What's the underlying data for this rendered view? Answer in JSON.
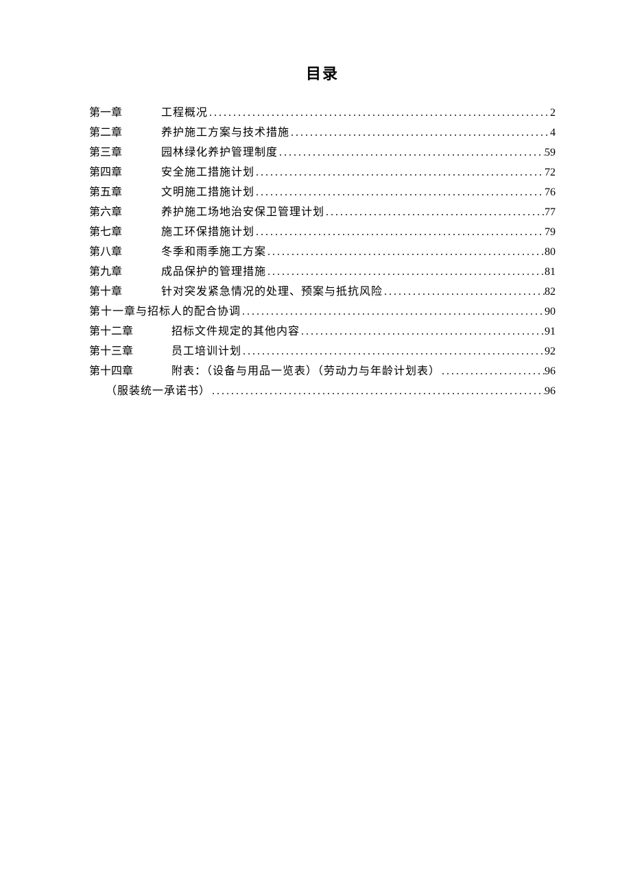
{
  "title": "目录",
  "entries": [
    {
      "chapter": "第一章",
      "text": "工程概况",
      "page": "2",
      "wideChapter": false,
      "indent": false,
      "hasChapterCol": true
    },
    {
      "chapter": "第二章",
      "text": "养护施工方案与技术措施",
      "page": "4",
      "wideChapter": false,
      "indent": false,
      "hasChapterCol": true
    },
    {
      "chapter": "第三章",
      "text": "园林绿化养护管理制度 ",
      "page": "59",
      "wideChapter": false,
      "indent": false,
      "hasChapterCol": true
    },
    {
      "chapter": "第四章",
      "text": "安全施工措施计划 ",
      "page": "72",
      "wideChapter": false,
      "indent": false,
      "hasChapterCol": true
    },
    {
      "chapter": "第五章",
      "text": "文明施工措施计划 ",
      "page": "76",
      "wideChapter": false,
      "indent": false,
      "hasChapterCol": true
    },
    {
      "chapter": "第六章",
      "text": "养护施工场地治安保卫管理计划 ",
      "page": "77",
      "wideChapter": false,
      "indent": false,
      "hasChapterCol": true
    },
    {
      "chapter": "第七章",
      "text": "施工环保措施计划 ",
      "page": "79",
      "wideChapter": false,
      "indent": false,
      "hasChapterCol": true
    },
    {
      "chapter": "第八章",
      "text": "冬季和雨季施工方案 ",
      "page": "80",
      "wideChapter": false,
      "indent": false,
      "hasChapterCol": true
    },
    {
      "chapter": "第九章",
      "text": "成品保护的管理措施 ",
      "page": "81",
      "wideChapter": false,
      "indent": false,
      "hasChapterCol": true
    },
    {
      "chapter": "第十章",
      "text": "针对突发紧急情况的处理、预案与抵抗风险 ",
      "page": "82",
      "wideChapter": false,
      "indent": false,
      "hasChapterCol": true
    },
    {
      "chapter": "",
      "text": "第十一章与招标人的配合协调",
      "page": "90",
      "wideChapter": false,
      "indent": false,
      "hasChapterCol": false
    },
    {
      "chapter": "第十二章",
      "text": "招标文件规定的其他内容 ",
      "page": "91",
      "wideChapter": true,
      "indent": false,
      "hasChapterCol": true
    },
    {
      "chapter": "第十三章",
      "text": "员工培训计划 ",
      "page": "92",
      "wideChapter": true,
      "indent": false,
      "hasChapterCol": true
    },
    {
      "chapter": "第十四章",
      "text": "附表：（设备与用品一览表）（劳动力与年龄计划表） ",
      "page": "96",
      "wideChapter": true,
      "indent": false,
      "hasChapterCol": true
    },
    {
      "chapter": "",
      "text": "（服装统一承诺书） ",
      "page": "96",
      "wideChapter": false,
      "indent": true,
      "hasChapterCol": false
    }
  ]
}
